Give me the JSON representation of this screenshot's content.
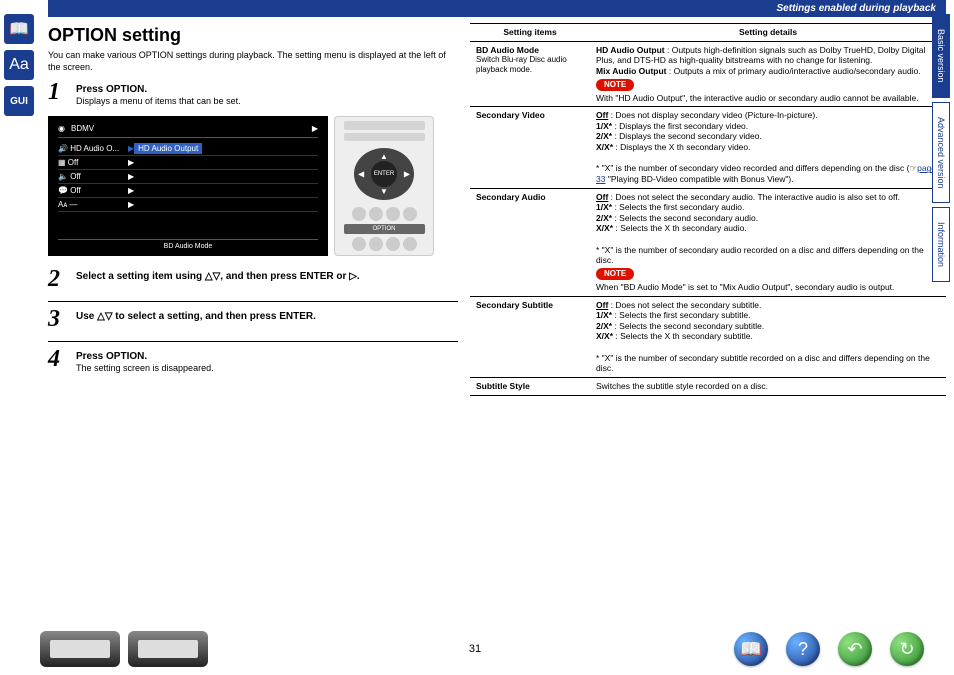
{
  "header": {
    "label": "Settings enabled during playback"
  },
  "title": "OPTION setting",
  "intro": "You can make various OPTION settings during playback. The setting menu is displayed at the left of the screen.",
  "steps": [
    {
      "num": "1",
      "head": "Press OPTION.",
      "body": "Displays a menu of items that can be set."
    },
    {
      "num": "2",
      "head": "Select a setting item using △▽, and then press ENTER or ▷.",
      "body": ""
    },
    {
      "num": "3",
      "head": "Use △▽ to select a setting, and then press ENTER.",
      "body": ""
    },
    {
      "num": "4",
      "head": "Press OPTION.",
      "body": "The setting screen is disappeared."
    }
  ],
  "osd": {
    "top": "BDMV",
    "rows": [
      {
        "icon": "🔊",
        "label": "HD Audio O...",
        "val": "HD Audio Output",
        "selected": true
      },
      {
        "icon": "▦",
        "label": "Off",
        "val": ""
      },
      {
        "icon": "🔈",
        "label": "Off",
        "val": ""
      },
      {
        "icon": "💬",
        "label": "Off",
        "val": ""
      },
      {
        "icon": "Aᴀ",
        "label": "—",
        "val": ""
      }
    ],
    "bottom": "BD Audio Mode"
  },
  "remote": {
    "enter": "ENTER",
    "option": "OPTION"
  },
  "table": {
    "headers": [
      "Setting items",
      "Setting details"
    ],
    "rows": [
      {
        "item": "BD Audio Mode",
        "sub": "Switch Blu-ray Disc audio playback mode.",
        "details": "HD Audio Output : Outputs high-definition signals such as Dolby TrueHD, Dolby Digital Plus, and DTS-HD as high-quality bitstreams with no change for listening.\nMix Audio Output : Outputs a mix of primary audio/interactive audio/secondary audio.",
        "note": "With \"HD Audio Output\", the interactive audio or secondary audio cannot be available."
      },
      {
        "item": "Secondary Video",
        "details": "Off : Does not display secondary video (Picture-In-picture).\n1/X* : Displays the first secondary video.\n2/X* : Displays the second secondary video.\nX/X* : Displays the X th secondary video.",
        "foot": "* \"X\" is the number of secondary video recorded and differs depending on the disc (☞ page 33 \"Playing BD-Video compatible with Bonus View\").",
        "link": "page 33"
      },
      {
        "item": "Secondary Audio",
        "details": "Off : Does not select the secondary audio. The interactive audio is also set to off.\n1/X* : Selects the first secondary audio.\n2/X* : Selects the second secondary audio.\nX/X* : Selects the X th secondary audio.",
        "foot": "* \"X\" is the number of secondary audio recorded on a disc and differs depending on the disc.",
        "note": "When \"BD Audio Mode\" is set to \"Mix Audio Output\", secondary audio is output."
      },
      {
        "item": "Secondary Subtitle",
        "details": "Off : Does not select the secondary subtitle.\n1/X* : Selects the first secondary subtitle.\n2/X* : Selects the second secondary subtitle.\nX/X* : Selects the X th secondary subtitle.",
        "foot": "* \"X\" is the number of secondary subtitle recorded on a disc and differs depending on the disc."
      },
      {
        "item": "Subtitle Style",
        "details": "Switches the subtitle style recorded on a disc."
      }
    ]
  },
  "note_label": "NOTE",
  "tabs": [
    {
      "label": "Basic version",
      "active": true
    },
    {
      "label": "Advanced version",
      "active": false
    },
    {
      "label": "Information",
      "active": false
    }
  ],
  "page_number": "31",
  "left_icons": [
    "book-icon",
    "aa-icon",
    "gui-icon"
  ],
  "footer_icons": {
    "book": "📖",
    "help": "?",
    "back": "↶",
    "refresh": "↻"
  }
}
